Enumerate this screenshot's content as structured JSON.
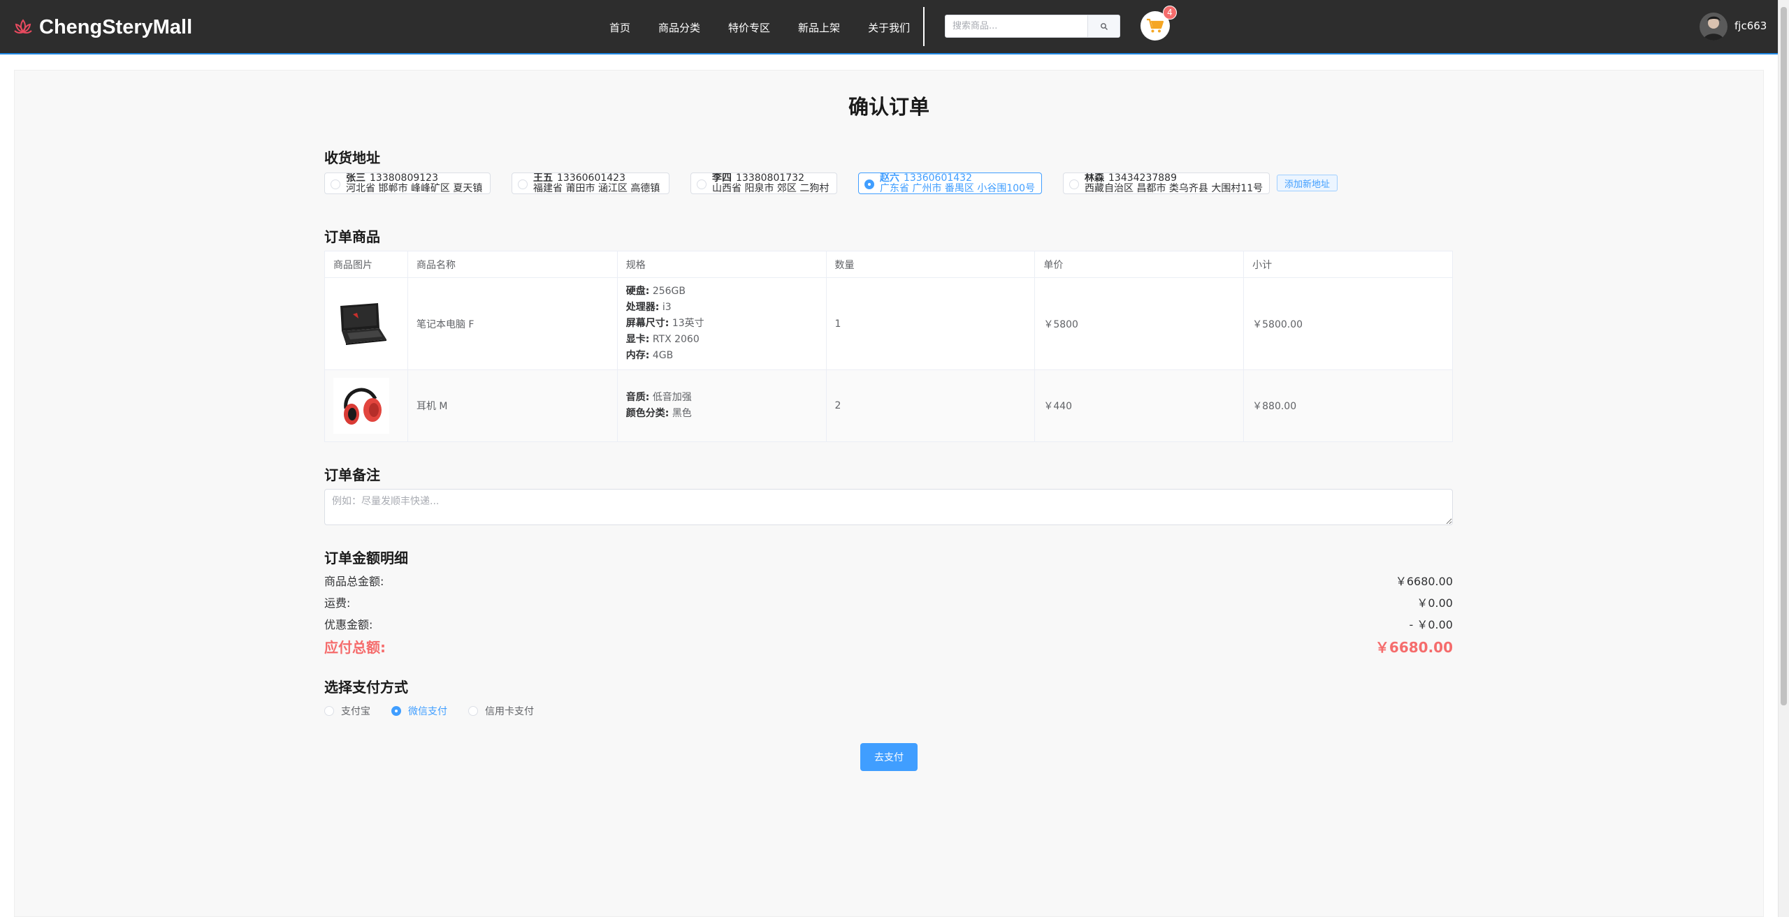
{
  "header": {
    "logo_text": "ChengSteryMall",
    "nav": [
      "首页",
      "商品分类",
      "特价专区",
      "新品上架",
      "关于我们"
    ],
    "search_placeholder": "搜索商品...",
    "cart_count": "4",
    "username": "fjc663"
  },
  "page": {
    "title": "确认订单"
  },
  "address": {
    "title": "收货地址",
    "items": [
      {
        "name": "张三",
        "phone": "13380809123",
        "detail": "河北省 邯郸市 峰峰矿区 夏天镇",
        "selected": false
      },
      {
        "name": "王五",
        "phone": "13360601423",
        "detail": "福建省 莆田市 涵江区 高德镇",
        "selected": false
      },
      {
        "name": "李四",
        "phone": "13380801732",
        "detail": "山西省 阳泉市 郊区 二狗村",
        "selected": false
      },
      {
        "name": "赵六",
        "phone": "13360601432",
        "detail": "广东省 广州市 番禺区 小谷围100号",
        "selected": true
      },
      {
        "name": "林森",
        "phone": "13434237889",
        "detail": "西藏自治区 昌都市 类乌齐县 大围村11号",
        "selected": false
      }
    ],
    "add_label": "添加新地址"
  },
  "goods": {
    "title": "订单商品",
    "columns": [
      "商品图片",
      "商品名称",
      "规格",
      "数量",
      "单价",
      "小计"
    ],
    "rows": [
      {
        "name": "笔记本电脑 F",
        "specs": [
          {
            "key": "硬盘:",
            "value": "256GB"
          },
          {
            "key": "处理器:",
            "value": "i3"
          },
          {
            "key": "屏幕尺寸:",
            "value": "13英寸"
          },
          {
            "key": "显卡:",
            "value": "RTX 2060"
          },
          {
            "key": "内存:",
            "value": "4GB"
          }
        ],
        "qty": "1",
        "price": "￥5800",
        "subtotal": "￥5800.00"
      },
      {
        "name": "耳机 M",
        "specs": [
          {
            "key": "音质:",
            "value": "低音加强"
          },
          {
            "key": "颜色分类:",
            "value": "黑色"
          }
        ],
        "qty": "2",
        "price": "￥440",
        "subtotal": "￥880.00"
      }
    ]
  },
  "remark": {
    "title": "订单备注",
    "placeholder": "例如：尽量发顺丰快递..."
  },
  "amount": {
    "title": "订单金额明细",
    "goods_label": "商品总金额:",
    "goods_value": "￥6680.00",
    "freight_label": "运费:",
    "freight_value": "￥0.00",
    "discount_label": "优惠金额:",
    "discount_value": "- ￥0.00",
    "total_label": "应付总额:",
    "total_value": "￥6680.00"
  },
  "payment": {
    "title": "选择支付方式",
    "options": [
      {
        "label": "支付宝",
        "selected": false
      },
      {
        "label": "微信支付",
        "selected": true
      },
      {
        "label": "信用卡支付",
        "selected": false
      }
    ],
    "button": "去支付"
  },
  "colors": {
    "accent": "#409eff",
    "danger": "#f56c6c",
    "header_bg": "#2d2d2d"
  }
}
